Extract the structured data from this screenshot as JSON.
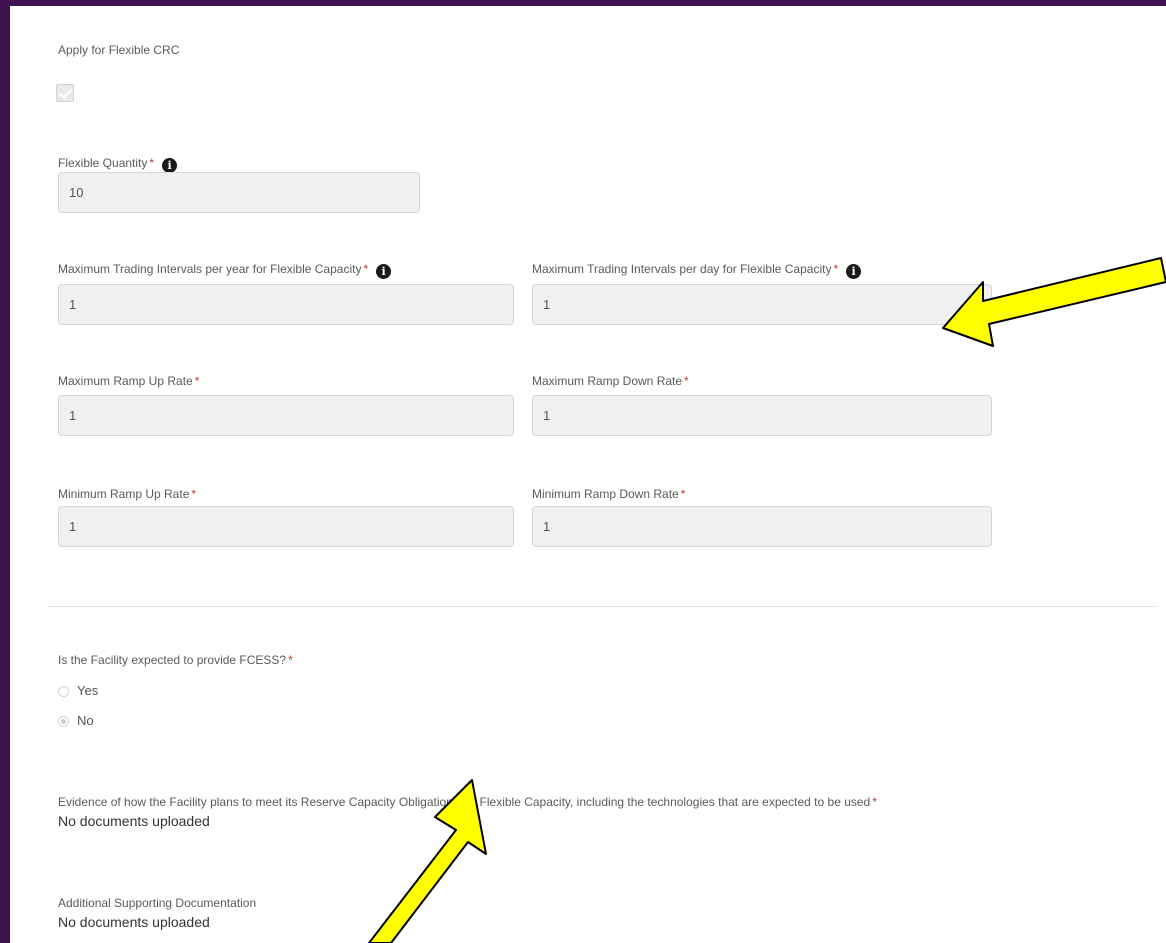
{
  "flexible_crc": {
    "label": "Apply for Flexible CRC",
    "checked": true
  },
  "required_mark": "*",
  "info_glyph": "i",
  "fields": {
    "flexible_quantity": {
      "label": "Flexible Quantity",
      "value": "10"
    },
    "max_intervals_year": {
      "label": "Maximum Trading Intervals per year for Flexible Capacity",
      "value": "1"
    },
    "max_intervals_day": {
      "label": "Maximum Trading Intervals per day for Flexible Capacity",
      "value": "1"
    },
    "max_ramp_up": {
      "label": "Maximum Ramp Up Rate",
      "value": "1"
    },
    "max_ramp_down": {
      "label": "Maximum Ramp Down Rate",
      "value": "1"
    },
    "min_ramp_up": {
      "label": "Minimum Ramp Up Rate",
      "value": "1"
    },
    "min_ramp_down": {
      "label": "Minimum Ramp Down Rate",
      "value": "1"
    }
  },
  "fcess": {
    "question": "Is the Facility expected to provide FCESS?",
    "options": [
      {
        "label": "Yes",
        "selected": false
      },
      {
        "label": "No",
        "selected": true
      }
    ]
  },
  "evidence": {
    "label": "Evidence of how the Facility plans to meet its Reserve Capacity Obligations for Flexible Capacity, including the technologies that are expected to be used",
    "status": "No documents uploaded"
  },
  "supporting": {
    "label": "Additional Supporting Documentation",
    "status": "No documents uploaded"
  },
  "colors": {
    "frame": "#3d1450",
    "required": "#c23934",
    "annotation_arrow": "#ffff00"
  }
}
